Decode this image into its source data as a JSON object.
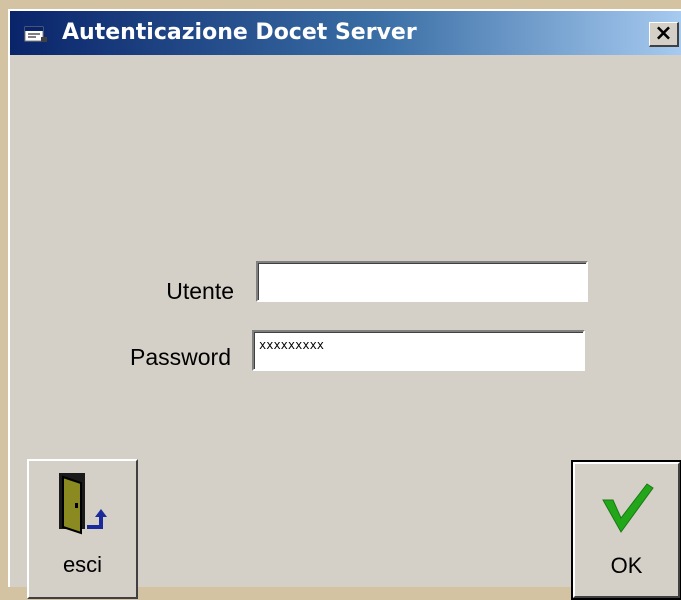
{
  "window": {
    "title": "Autenticazione Docet Server",
    "close_label": "×"
  },
  "login": {
    "user_label": "Utente",
    "user_value": "",
    "password_label": "Password",
    "password_value": "xxxxxxxxx"
  },
  "buttons": {
    "exit_label": "esci",
    "exit_icon": "door-exit-icon",
    "ok_label": "OK",
    "ok_icon": "checkmark-icon"
  },
  "colors": {
    "titlebar_start": "#0a246a",
    "titlebar_end": "#a6caf0",
    "dialog_bg": "#d4d0c8",
    "checkmark": "#22a61a"
  }
}
